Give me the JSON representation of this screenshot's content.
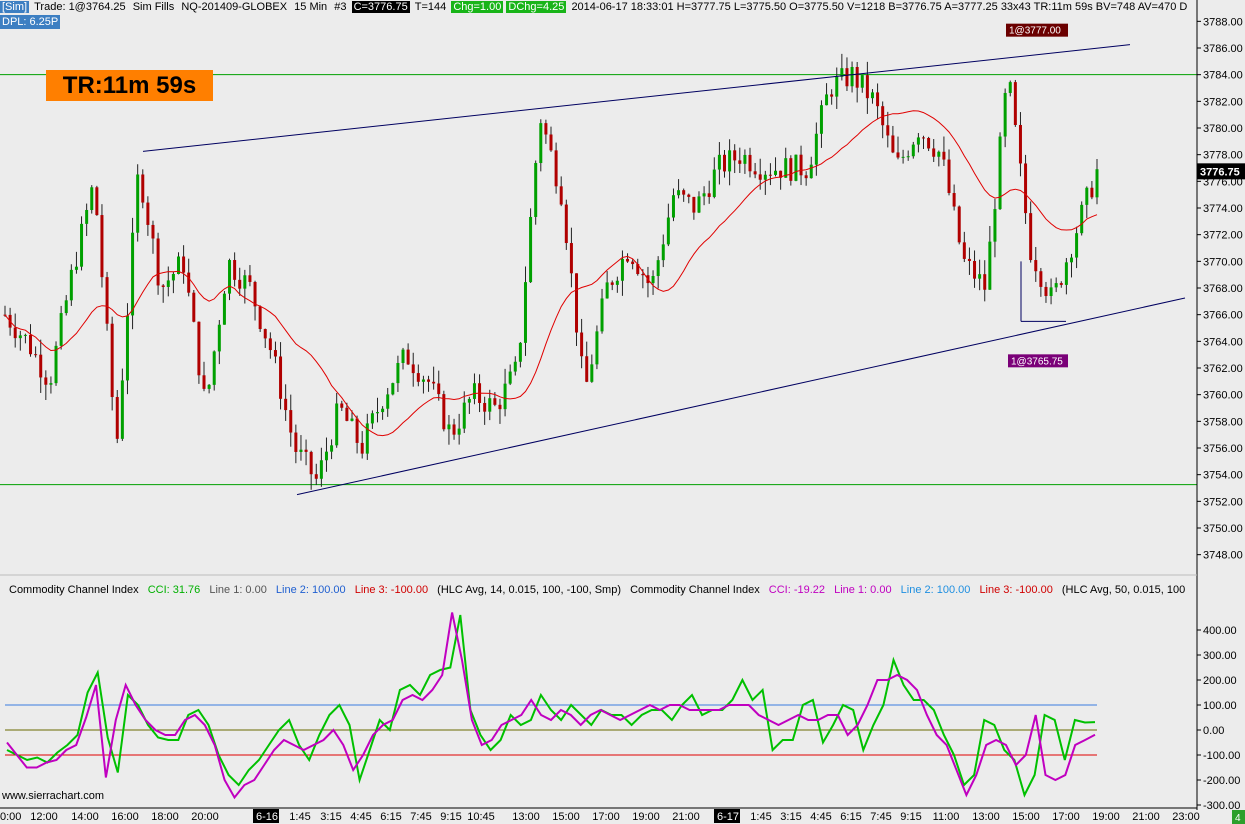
{
  "header": {
    "sim": "[Sim]",
    "trade": "Trade: 1@3764.25",
    "fills": "Sim Fills",
    "symbol": "NQ-201409-GLOBEX",
    "interval": "15 Min",
    "num": "#3",
    "close": "C=3776.75",
    "ticks": "T=144",
    "chg": "Chg=1.00",
    "dchg": "DChg=4.25",
    "stats": "2014-06-17 18:33:01 H=3777.75 L=3775.50 O=3775.50 V=1218 B=3776.75 A=3777.25 33x43 TR:11m 59s BV=748 AV=470 D",
    "dpl": "DPL: 6.25P"
  },
  "timer": "TR:11m 59s",
  "price_tag": "3776.75",
  "labels": {
    "high": "1@3777.00",
    "low": "1@3765.75"
  },
  "cci_header": {
    "name1": "Commodity Channel Index",
    "cci1": "CCI: 31.76",
    "l1a": "Line 1: 0.00",
    "l2a": "Line 2: 100.00",
    "l3a": "Line 3: -100.00",
    "params1": "(HLC Avg, 14, 0.015, 100, -100, Smp)",
    "name2": "Commodity Channel Index",
    "cci2": "CCI: -19.22",
    "l1b": "Line 1: 0.00",
    "l2b": "Line 2: 100.00",
    "l3b": "Line 3: -100.00",
    "params2": "(HLC Avg, 50, 0.015, 100"
  },
  "credit": "www.sierrachart.com",
  "corner_badge": "4",
  "colors": {
    "up": "#00a000",
    "down": "#b00000",
    "ma": "#e00000",
    "trend": "#000060",
    "hline": "#00a000",
    "cci14": "#00c000",
    "cci50": "#c000c0",
    "cci_upper": "#3a7be0",
    "cci_lower": "#e00000",
    "cci_zero": "#6a6a00"
  },
  "chart_data": {
    "type": "candlestick",
    "symbol": "NQ-201409-GLOBEX",
    "interval": "15 Min",
    "price_axis": {
      "ylim": [
        3747,
        3789
      ],
      "ticks": [
        "3788.00",
        "3786.00",
        "3784.00",
        "3782.00",
        "3780.00",
        "3778.00",
        "3776.00",
        "3774.00",
        "3772.00",
        "3770.00",
        "3768.00",
        "3766.00",
        "3764.00",
        "3762.00",
        "3760.00",
        "3758.00",
        "3756.00",
        "3754.00",
        "3752.00",
        "3750.00",
        "3748.00"
      ]
    },
    "time_axis": [
      {
        "label": "0:00",
        "x": 0
      },
      {
        "label": "12:00",
        "x": 44
      },
      {
        "label": "14:00",
        "x": 85
      },
      {
        "label": "16:00",
        "x": 125
      },
      {
        "label": "18:00",
        "x": 165
      },
      {
        "label": "20:00",
        "x": 205
      },
      {
        "label": "6-16",
        "x": 265,
        "date": true
      },
      {
        "label": "1:45",
        "x": 300
      },
      {
        "label": "3:15",
        "x": 331
      },
      {
        "label": "4:45",
        "x": 361
      },
      {
        "label": "6:15",
        "x": 391
      },
      {
        "label": "7:45",
        "x": 421
      },
      {
        "label": "9:15",
        "x": 451
      },
      {
        "label": "10:45",
        "x": 481
      },
      {
        "label": "13:00",
        "x": 526
      },
      {
        "label": "15:00",
        "x": 566
      },
      {
        "label": "17:00",
        "x": 606
      },
      {
        "label": "19:00",
        "x": 646
      },
      {
        "label": "21:00",
        "x": 686
      },
      {
        "label": "6-17",
        "x": 726,
        "date": true
      },
      {
        "label": "1:45",
        "x": 761
      },
      {
        "label": "3:15",
        "x": 791
      },
      {
        "label": "4:45",
        "x": 821
      },
      {
        "label": "6:15",
        "x": 851
      },
      {
        "label": "7:45",
        "x": 881
      },
      {
        "label": "9:15",
        "x": 911
      },
      {
        "label": "11:00",
        "x": 946
      },
      {
        "label": "13:00",
        "x": 986
      },
      {
        "label": "15:00",
        "x": 1026
      },
      {
        "label": "17:00",
        "x": 1066
      },
      {
        "label": "19:00",
        "x": 1106
      },
      {
        "label": "21:00",
        "x": 1146
      },
      {
        "label": "23:00",
        "x": 1186
      }
    ],
    "horizontal_lines": [
      3784.0,
      3753.25
    ],
    "trendlines": [
      {
        "from": [
          "16:45",
          3778.25
        ],
        "to": [
          "6-17 21:00",
          3786.25
        ]
      },
      {
        "from": [
          "1:45",
          3752.5
        ],
        "to": [
          "6-17 21:00",
          3767.25
        ]
      }
    ],
    "price_path": [
      {
        "t": "0:00",
        "p": 3766
      },
      {
        "t": "12:00",
        "p": 3764
      },
      {
        "t": "14:00",
        "p": 3761
      },
      {
        "t": "15:00",
        "p": 3769
      },
      {
        "t": "16:00",
        "p": 3776
      },
      {
        "t": "16:30",
        "p": 3756
      },
      {
        "t": "17:00",
        "p": 3777
      },
      {
        "t": "18:00",
        "p": 3768
      },
      {
        "t": "20:00",
        "p": 3770
      },
      {
        "t": "21:00",
        "p": 3759
      },
      {
        "t": "22:00",
        "p": 3770
      },
      {
        "t": "6-16",
        "p": 3768
      },
      {
        "t": "1:00",
        "p": 3763
      },
      {
        "t": "1:45",
        "p": 3756
      },
      {
        "t": "3:15",
        "p": 3753.5
      },
      {
        "t": "4:45",
        "p": 3759
      },
      {
        "t": "6:15",
        "p": 3756
      },
      {
        "t": "7:45",
        "p": 3760
      },
      {
        "t": "9:15",
        "p": 3763
      },
      {
        "t": "10:45",
        "p": 3761
      },
      {
        "t": "12:00",
        "p": 3757
      },
      {
        "t": "13:00",
        "p": 3760
      },
      {
        "t": "14:00",
        "p": 3759
      },
      {
        "t": "15:00",
        "p": 3762
      },
      {
        "t": "15:45",
        "p": 3781
      },
      {
        "t": "16:30",
        "p": 3775
      },
      {
        "t": "17:00",
        "p": 3760
      },
      {
        "t": "18:00",
        "p": 3768
      },
      {
        "t": "20:00",
        "p": 3771
      },
      {
        "t": "21:00",
        "p": 3768
      },
      {
        "t": "23:00",
        "p": 3775
      },
      {
        "t": "6-17",
        "p": 3774
      },
      {
        "t": "1:45",
        "p": 3777
      },
      {
        "t": "3:15",
        "p": 3778
      },
      {
        "t": "4:45",
        "p": 3777
      },
      {
        "t": "6:15",
        "p": 3777
      },
      {
        "t": "7:45",
        "p": 3777
      },
      {
        "t": "9:15",
        "p": 3783
      },
      {
        "t": "10:00",
        "p": 3784
      },
      {
        "t": "11:00",
        "p": 3782
      },
      {
        "t": "12:00",
        "p": 3777
      },
      {
        "t": "13:00",
        "p": 3780
      },
      {
        "t": "14:00",
        "p": 3778
      },
      {
        "t": "14:30",
        "p": 3770
      },
      {
        "t": "15:00",
        "p": 3768
      },
      {
        "t": "15:30",
        "p": 3784
      },
      {
        "t": "16:00",
        "p": 3771
      },
      {
        "t": "16:30",
        "p": 3767
      },
      {
        "t": "17:00",
        "p": 3772
      },
      {
        "t": "18:00",
        "p": 3776.75
      }
    ],
    "moving_average": {
      "color": "red",
      "values": [
        3768,
        3767,
        3764,
        3766,
        3769,
        3768,
        3766,
        3760,
        3758,
        3760,
        3760,
        3759,
        3761,
        3768,
        3767,
        3768,
        3772,
        3774,
        3776,
        3777,
        3778,
        3781,
        3780,
        3778,
        3777,
        3776
      ]
    },
    "last_price": 3776.75,
    "annotations": [
      "1@3777.00",
      "1@3765.75"
    ]
  },
  "cci_chart": {
    "ylim": [
      -300,
      500
    ],
    "ticks": [
      "400.00",
      "300.00",
      "200.00",
      "100.00",
      "0.00",
      "-100.00",
      "-200.00",
      "-300.00"
    ],
    "reference_lines": [
      100,
      0,
      -100
    ],
    "series": [
      {
        "name": "CCI 14",
        "values": [
          -80,
          -100,
          -120,
          -110,
          -130,
          -90,
          -60,
          -20,
          150,
          230,
          -30,
          -170,
          140,
          100,
          20,
          -30,
          -40,
          -40,
          60,
          80,
          20,
          -100,
          -180,
          -220,
          -160,
          -120,
          -60,
          0,
          40,
          -60,
          -120,
          -20,
          60,
          100,
          20,
          -200,
          -80,
          40,
          0,
          160,
          180,
          140,
          220,
          240,
          250,
          460,
          80,
          -20,
          -80,
          -40,
          60,
          20,
          40,
          140,
          80,
          40,
          100,
          60,
          20,
          80,
          60,
          60,
          20,
          60,
          80,
          80,
          40,
          100,
          140,
          60,
          80,
          80,
          120,
          200,
          120,
          160,
          -80,
          -40,
          -40,
          100,
          120,
          -50,
          20,
          100,
          80,
          -80,
          20,
          100,
          280,
          180,
          120,
          120,
          80,
          -20,
          -100,
          -220,
          -180,
          40,
          20,
          -80,
          -120,
          -260,
          -180,
          60,
          40,
          -120,
          40,
          30,
          31.76
        ]
      },
      {
        "name": "CCI 50",
        "values": [
          -50,
          -100,
          -150,
          -150,
          -130,
          -120,
          -80,
          -60,
          50,
          180,
          -190,
          40,
          180,
          100,
          40,
          0,
          -20,
          -20,
          40,
          60,
          20,
          -60,
          -200,
          -270,
          -220,
          -200,
          -140,
          -80,
          -40,
          -60,
          -80,
          -60,
          -40,
          0,
          -60,
          -160,
          -100,
          -20,
          20,
          40,
          120,
          140,
          120,
          160,
          220,
          470,
          280,
          40,
          -60,
          -40,
          20,
          40,
          60,
          120,
          60,
          40,
          80,
          60,
          20,
          60,
          80,
          60,
          40,
          60,
          80,
          100,
          80,
          100,
          100,
          80,
          80,
          80,
          80,
          100,
          100,
          100,
          60,
          40,
          20,
          40,
          60,
          40,
          40,
          60,
          60,
          -20,
          20,
          100,
          200,
          200,
          220,
          200,
          160,
          60,
          -20,
          -60,
          -160,
          -260,
          -180,
          -60,
          -40,
          -60,
          -140,
          -100,
          60,
          -180,
          -200,
          -180,
          -60,
          -40,
          -19.22
        ]
      }
    ]
  }
}
